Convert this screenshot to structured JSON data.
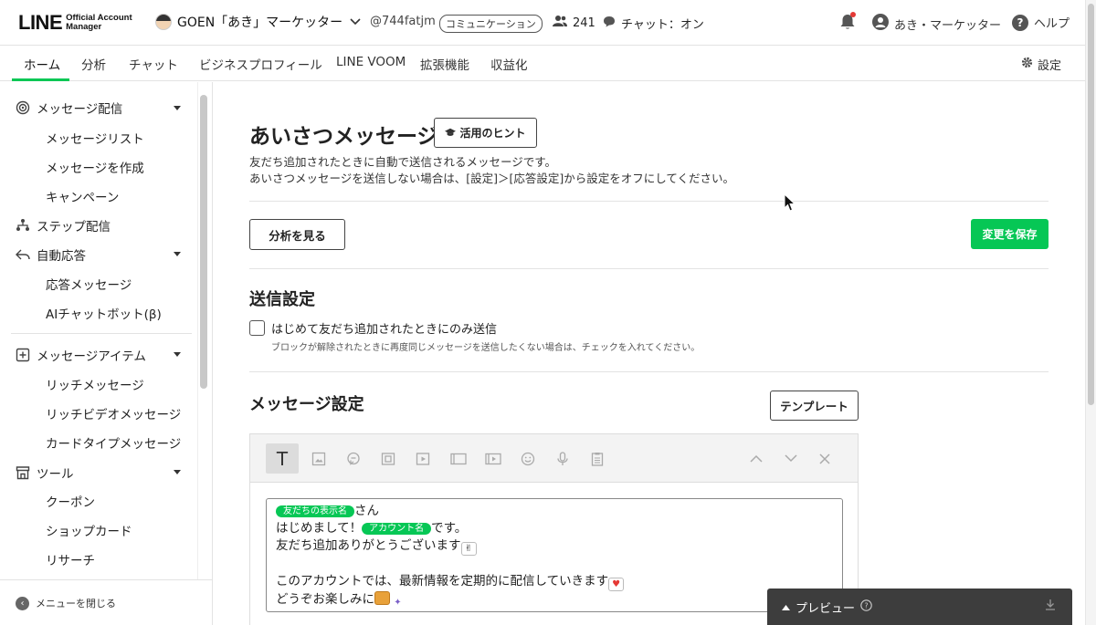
{
  "header": {
    "logo_main": "LINE",
    "logo_sub_1": "Official Account",
    "logo_sub_2": "Manager",
    "account_name": "GOEN「あき」マーケッター",
    "account_id": "@744fatjm",
    "plan_badge": "コミュニケーション",
    "friend_count": "241",
    "chat_status": "チャット：オン",
    "user_name": "あき・マーケッター",
    "help_label": "ヘルプ"
  },
  "nav": {
    "tabs": [
      {
        "label": "ホーム"
      },
      {
        "label": "分析"
      },
      {
        "label": "チャット"
      },
      {
        "label": "ビジネスプロフィール"
      },
      {
        "label": "LINE VOOM"
      },
      {
        "label": "拡張機能"
      },
      {
        "label": "収益化"
      }
    ],
    "active_tab": "ホーム",
    "settings_label": "設定"
  },
  "sidebar": {
    "groups": [
      {
        "label": "メッセージ配信",
        "items": [
          "メッセージリスト",
          "メッセージを作成",
          "キャンペーン"
        ]
      },
      {
        "label": "ステップ配信"
      },
      {
        "label": "自動応答",
        "items": [
          "応答メッセージ",
          "AIチャットボット(β)"
        ]
      },
      {
        "label": "メッセージアイテム",
        "items": [
          "リッチメッセージ",
          "リッチビデオメッセージ",
          "カードタイプメッセージ"
        ]
      },
      {
        "label": "ツール",
        "items": [
          "クーポン",
          "ショップカード",
          "リサーチ"
        ]
      }
    ],
    "close_menu_label": "メニューを閉じる"
  },
  "main": {
    "title": "あいさつメッセージ",
    "hint_button": "活用のヒント",
    "description_line1": "友だち追加されたときに自動で送信されるメッセージです。",
    "description_line2": "あいさつメッセージを送信しない場合は、[設定]＞[応答設定]から設定をオフにしてください。",
    "analytics_button": "分析を見る",
    "save_button": "変更を保存",
    "send_settings_title": "送信設定",
    "checkbox_label": "はじめて友だち追加されたときにのみ送信",
    "checkbox_checked": false,
    "checkbox_note": "ブロックが解除されたときに再度同じメッセージを送信したくない場合は、チェックを入れてください。",
    "message_settings_title": "メッセージ設定",
    "template_button": "テンプレート"
  },
  "editor": {
    "toolbar_icons": [
      "text-icon",
      "image-icon",
      "sticker-icon",
      "coupon-icon",
      "video-icon",
      "rich-message-icon",
      "rich-video-icon",
      "emoji-icon",
      "voice-icon",
      "survey-icon"
    ],
    "chip_friend_name": "友だちの表示名",
    "line1_suffix": "さん",
    "line2_prefix": "はじめまして！",
    "chip_account_name": "アカウント名",
    "line2_suffix": "です。",
    "line3": "友だち追加ありがとうございます",
    "line4": "このアカウントでは、最新情報を定期的に配信していきます",
    "line5": "どうぞお楽しみに"
  },
  "preview": {
    "label": "プレビュー"
  },
  "colors": {
    "accent": "#06c755",
    "preview_bg": "#3d3d3d"
  }
}
